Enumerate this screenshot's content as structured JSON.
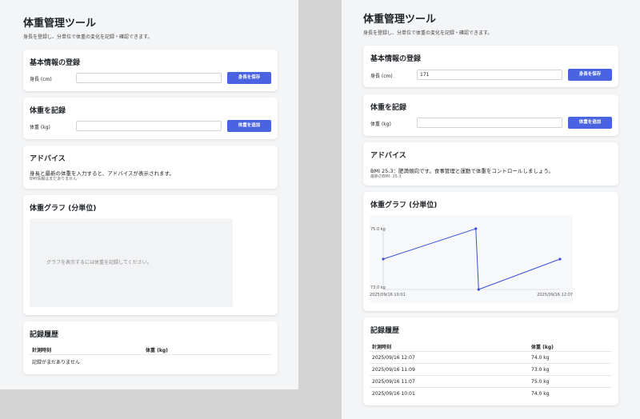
{
  "left": {
    "title": "体重管理ツール",
    "subtitle": "身長を登録し、分単位で体重の変化を記録・確認できます。",
    "basic": {
      "title": "基本情報の登録",
      "height_label": "身長 (cm)",
      "height_value": "",
      "save_button": "身長を保存"
    },
    "record": {
      "title": "体重を記録",
      "weight_label": "体重 (kg)",
      "weight_value": "",
      "add_button": "体重を追加"
    },
    "advice": {
      "title": "アドバイス",
      "message": "身長と最新の体重を入力すると、アドバイスが表示されます。",
      "sub": "BMI情報はまだありません"
    },
    "chart": {
      "title": "体重グラフ (分単位)",
      "empty_text": "グラフを表示するには体重を記録してください。"
    },
    "history": {
      "title": "記録履歴",
      "col_time": "計測時刻",
      "col_weight": "体重 (kg)",
      "empty": "記録がまだありません"
    }
  },
  "right": {
    "title": "体重管理ツール",
    "subtitle": "身長を登録し、分単位で体重の変化を記録・確認できます。",
    "basic": {
      "title": "基本情報の登録",
      "height_label": "身長 (cm)",
      "height_value": "171",
      "save_button": "身長を保存"
    },
    "record": {
      "title": "体重を記録",
      "weight_label": "体重 (kg)",
      "weight_value": "",
      "add_button": "体重を追加"
    },
    "advice": {
      "title": "アドバイス",
      "message": "BMI 25.3：肥満傾向です。食事管理と運動で体重をコントロールしましょう。",
      "sub": "最新のBMI: 25.3"
    },
    "chart": {
      "title": "体重グラフ (分単位)"
    },
    "history": {
      "title": "記録履歴",
      "col_time": "計測時刻",
      "col_weight": "体重 (kg)",
      "rows": [
        {
          "time": "2025/09/16 12:07",
          "weight": "74.0 kg"
        },
        {
          "time": "2025/09/16 11:09",
          "weight": "73.0 kg"
        },
        {
          "time": "2025/09/16 11:07",
          "weight": "75.0 kg"
        },
        {
          "time": "2025/09/16 10:01",
          "weight": "74.0 kg"
        }
      ]
    }
  },
  "chart_data": {
    "type": "line",
    "x": [
      "2025/09/16 10:01",
      "2025/09/16 11:07",
      "2025/09/16 11:09",
      "2025/09/16 12:07"
    ],
    "series": [
      {
        "values": [
          74.0,
          75.0,
          73.0,
          74.0
        ]
      }
    ],
    "ylim": [
      73.0,
      75.0
    ],
    "y_ticks": [
      "75.0 kg",
      "73.0 kg"
    ],
    "x_ticks": [
      "2025/09/16 10:01",
      "2025/09/16 12:07"
    ],
    "line_color": "#3b4fd8"
  }
}
